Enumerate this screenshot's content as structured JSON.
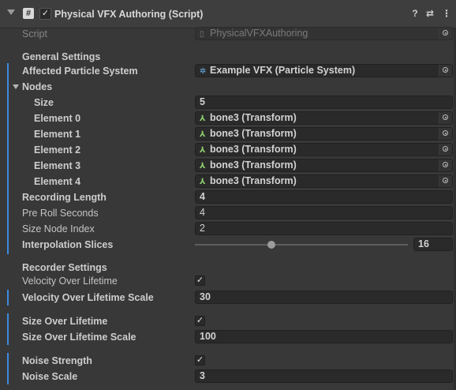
{
  "header": {
    "title": "Physical VFX Authoring (Script)",
    "enabled": true
  },
  "script": {
    "label": "Script",
    "value": "PhysicalVFXAuthoring"
  },
  "general": {
    "heading": "General Settings",
    "affected_label": "Affected Particle System",
    "affected_value": "Example VFX (Particle System)",
    "nodes_label": "Nodes",
    "size_label": "Size",
    "size_value": "5",
    "elements": [
      {
        "label": "Element 0",
        "value": "bone3 (Transform)"
      },
      {
        "label": "Element 1",
        "value": "bone3 (Transform)"
      },
      {
        "label": "Element 2",
        "value": "bone3 (Transform)"
      },
      {
        "label": "Element 3",
        "value": "bone3 (Transform)"
      },
      {
        "label": "Element 4",
        "value": "bone3 (Transform)"
      }
    ],
    "recording_label": "Recording Length",
    "recording_value": "4",
    "preroll_label": "Pre Roll Seconds",
    "preroll_value": "4",
    "sizenode_label": "Size Node Index",
    "sizenode_value": "2",
    "interp_label": "Interpolation Slices",
    "interp_value": "16",
    "interp_fraction": 0.36
  },
  "recorder": {
    "heading": "Recorder Settings",
    "vol_label": "Velocity Over Lifetime",
    "vol_checked": true,
    "vol_scale_label": "Velocity Over Lifetime Scale",
    "vol_scale_value": "30",
    "sol_label": "Size Over Lifetime",
    "sol_checked": true,
    "sol_scale_label": "Size Over Lifetime Scale",
    "sol_scale_value": "100",
    "noise_label": "Noise Strength",
    "noise_checked": true,
    "noise_scale_label": "Noise Scale",
    "noise_scale_value": "3"
  },
  "icons": {
    "header": [
      "script-icon",
      "help-icon",
      "preset-icon",
      "more-menu-icon"
    ],
    "object_picker": "object-picker-icon",
    "particle": "particle-system-icon",
    "transform": "transform-icon"
  },
  "colors": {
    "accent_bar": "#3d8ae0",
    "background": "#383838",
    "field": "#2a2a2a"
  }
}
